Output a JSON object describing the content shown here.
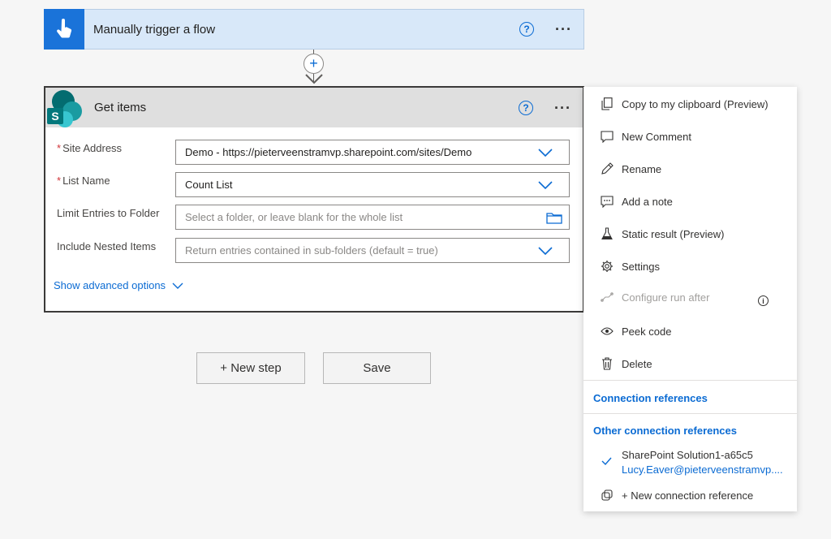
{
  "trigger": {
    "title": "Manually trigger a flow",
    "help": "?",
    "more": "···"
  },
  "connector": {
    "plus": "+"
  },
  "action": {
    "title": "Get items",
    "help": "?",
    "more": "···",
    "fields": [
      {
        "label": "Site Address",
        "required": true,
        "value": "Demo - https://pieterveenstramvp.sharepoint.com/sites/Demo",
        "type": "dropdown"
      },
      {
        "label": "List Name",
        "required": true,
        "value": "Count List",
        "type": "dropdown"
      },
      {
        "label": "Limit Entries to Folder",
        "required": false,
        "placeholder": "Select a folder, or leave blank for the whole list",
        "type": "folder"
      },
      {
        "label": "Include Nested Items",
        "required": false,
        "placeholder": "Return entries contained in sub-folders (default = true)",
        "type": "dropdown"
      }
    ],
    "advanced_label": "Show advanced options",
    "required_mark": "*"
  },
  "buttons": {
    "new_step": "+ New step",
    "save": "Save"
  },
  "menu": {
    "items": [
      {
        "label": "Copy to my clipboard (Preview)",
        "icon": "copy-icon"
      },
      {
        "label": "New Comment",
        "icon": "comment-icon"
      },
      {
        "label": "Rename",
        "icon": "pencil-icon"
      },
      {
        "label": "Add a note",
        "icon": "note-icon"
      },
      {
        "label": "Static result (Preview)",
        "icon": "flask-icon"
      },
      {
        "label": "Settings",
        "icon": "gear-icon"
      },
      {
        "label": "Configure run after",
        "icon": "run-after-icon",
        "disabled": true
      },
      {
        "label": "Peek code",
        "icon": "eye-icon"
      },
      {
        "label": "Delete",
        "icon": "trash-icon"
      }
    ],
    "info": "i",
    "connection_references": "Connection references",
    "other_connection_references": "Other connection references",
    "connection": {
      "name": "SharePoint Solution1-a65c5",
      "email": "Lucy.Eaver@pieterveenstramvp...."
    },
    "new_connection": "+ New connection reference"
  },
  "colors": {
    "accent": "#0b6bd3",
    "trigger_bg": "#d8e8f9",
    "trigger_icon_bg": "#1a73d9",
    "required": "#d13438"
  }
}
